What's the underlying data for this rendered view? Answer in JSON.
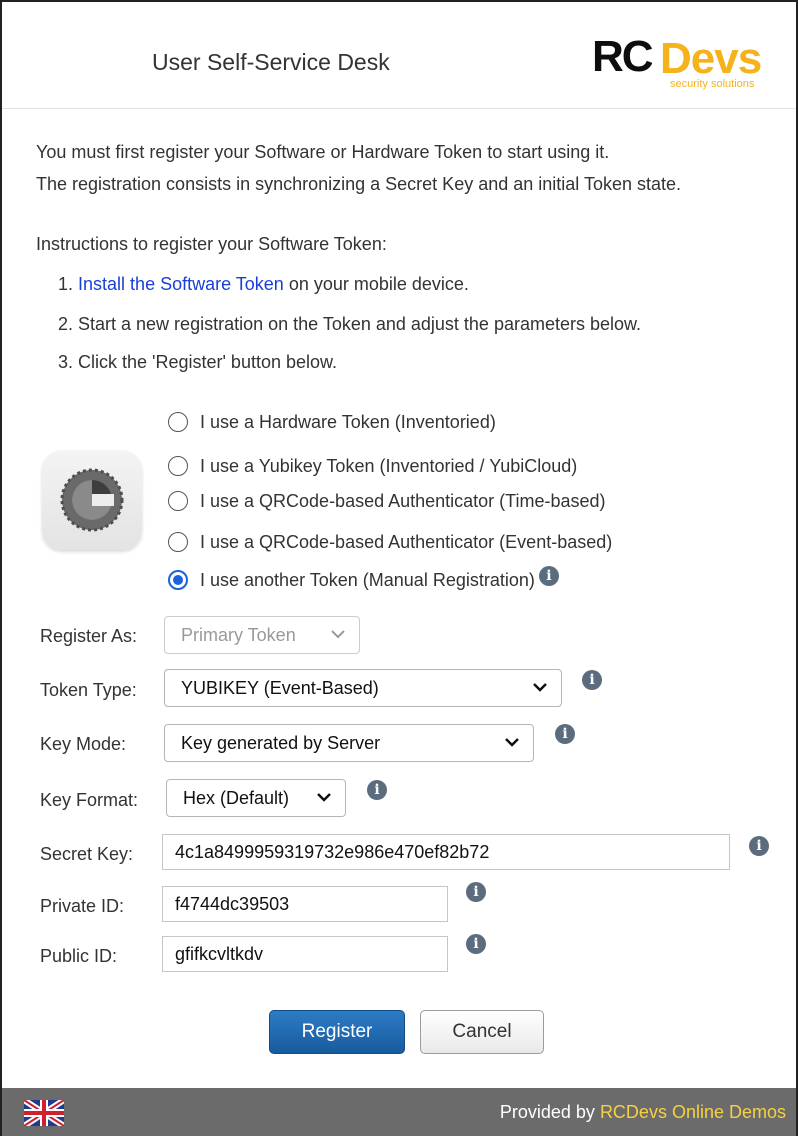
{
  "header": {
    "title": "User Self-Service Desk",
    "logo_rc": "RC",
    "logo_devs": "Devs",
    "logo_sub": "security solutions"
  },
  "intro": {
    "line1": "You must first register your Software or Hardware Token to start using it.",
    "line2": "The registration consists in synchronizing a Secret Key and an initial Token state."
  },
  "instructions": {
    "heading": "Instructions to register your Software Token:",
    "step1_num": "1.",
    "step1_link": "Install the Software Token",
    "step1_rest": " on your mobile device.",
    "step2": "2. Start a new registration on the Token and adjust the parameters below.",
    "step3": "3. Click the 'Register' button below."
  },
  "token_options": [
    {
      "label": "I use a Hardware Token (Inventoried)",
      "checked": false
    },
    {
      "label": "I use a Yubikey Token (Inventoried / YubiCloud)",
      "checked": false
    },
    {
      "label": "I use a QRCode-based Authenticator (Time-based)",
      "checked": false
    },
    {
      "label": "I use a QRCode-based Authenticator (Event-based)",
      "checked": false
    },
    {
      "label": "I use another Token (Manual Registration)",
      "checked": true
    }
  ],
  "form": {
    "register_as": {
      "label": "Register As:",
      "value": "Primary Token"
    },
    "token_type": {
      "label": "Token Type:",
      "value": "YUBIKEY (Event-Based)"
    },
    "key_mode": {
      "label": "Key Mode:",
      "value": "Key generated by Server"
    },
    "key_format": {
      "label": "Key Format:",
      "value": "Hex (Default)"
    },
    "secret_key": {
      "label": "Secret Key:",
      "value": "4c1a8499959319732e986e470ef82b72"
    },
    "private_id": {
      "label": "Private ID:",
      "value": "f4744dc39503"
    },
    "public_id": {
      "label": "Public ID:",
      "value": "gfifkcvltkdv"
    }
  },
  "buttons": {
    "register": "Register",
    "cancel": "Cancel"
  },
  "footer": {
    "provided_by": "Provided by ",
    "link": "RCDevs Online Demos"
  },
  "info_glyph": "i",
  "colors": {
    "primary_button": "#1f6bb3",
    "footer_bg": "#6b6b6b",
    "footer_link": "#f5d142",
    "logo_accent": "#f5b21b",
    "link": "#1a3fd8",
    "radio_checked": "#1a62e0"
  }
}
